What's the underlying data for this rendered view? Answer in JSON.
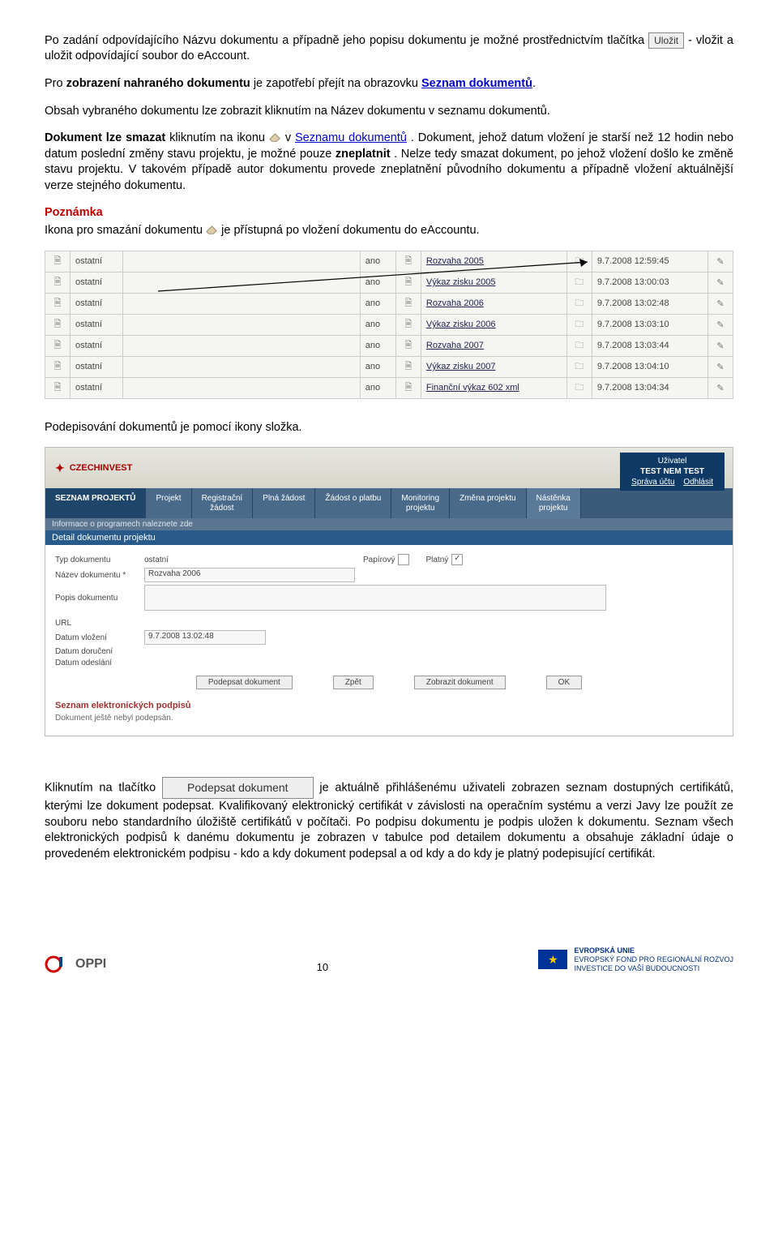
{
  "para1_a": "Po zadání odpovídajícího Názvu dokumentu a případně jeho popisu dokumentu je možné prostřednictvím tlačítka ",
  "btn_ulozit": "Uložit",
  "para1_b": " - vložit a uložit odpovídající soubor do eAccount.",
  "para2_a": "Pro ",
  "para2_b": "zobrazení nahraného dokumentu",
  "para2_c": " je zapotřebí přejít na obrazovku ",
  "para2_link": "Seznam dokumentů",
  "para2_d": ".",
  "para3": "Obsah vybraného dokumentu lze zobrazit kliknutím na Název dokumentu v seznamu dokumentů.",
  "para4_a": "Dokument lze smazat",
  "para4_b": " kliknutím na ikonu ",
  "para4_c": " v ",
  "para4_link": "Seznamu dokumentů",
  "para4_d": ". Dokument, jehož datum vložení je starší než 12 hodin nebo datum poslední změny stavu projektu, je možné pouze ",
  "para4_e": "zneplatnit",
  "para4_f": ". Nelze tedy smazat dokument, po jehož vložení došlo ke změně stavu projektu. V takovém případě autor dokumentu provede zneplatnění původního dokumentu a případně vložení aktuálnější verze stejného dokumentu.",
  "poznamka_label": "Poznámka",
  "poznamka_text_a": "Ikona pro smazání dokumentu ",
  "poznamka_text_b": " je přístupná po vložení dokumentu do eAccountu.",
  "table_rows": [
    {
      "type": "ostatní",
      "ano": "ano",
      "name": "Rozvaha 2005",
      "date": "9.7.2008 12:59:45"
    },
    {
      "type": "ostatní",
      "ano": "ano",
      "name": "Výkaz zisku 2005",
      "date": "9.7.2008 13:00:03"
    },
    {
      "type": "ostatní",
      "ano": "ano",
      "name": "Rozvaha 2006",
      "date": "9.7.2008 13:02:48"
    },
    {
      "type": "ostatní",
      "ano": "ano",
      "name": "Výkaz zisku 2006",
      "date": "9.7.2008 13:03:10"
    },
    {
      "type": "ostatní",
      "ano": "ano",
      "name": "Rozvaha 2007",
      "date": "9.7.2008 13:03:44"
    },
    {
      "type": "ostatní",
      "ano": "ano",
      "name": "Výkaz zisku 2007",
      "date": "9.7.2008 13:04:10"
    },
    {
      "type": "ostatní",
      "ano": "ano",
      "name": "Finanční výkaz 602 xml",
      "date": "9.7.2008 13:04:34"
    }
  ],
  "para_sign": "Podepisování dokumentů je pomocí ikony složka.",
  "app": {
    "brand": "CZECHINVEST",
    "user_label": "Uživatel",
    "user_name": "TEST NEM TEST",
    "link_sprava": "Správa účtu",
    "link_odhlasit": "Odhlásit",
    "tabs": [
      "SEZNAM PROJEKTŮ",
      "Projekt",
      "Registrační\nžádost",
      "Plná žádost",
      "Žádost o platbu",
      "Monitoring\nprojektu",
      "Změna projektu",
      "Nástěnka\nprojektu"
    ],
    "info_bar": "Informace o programech naleznete zde",
    "panel_title": "Detail dokumentu projektu",
    "fields": {
      "typ_label": "Typ dokumentu",
      "typ_value": "ostatní",
      "papirovy": "Papírový",
      "platny": "Platný",
      "nazev_label": "Název dokumentu *",
      "nazev_value": "Rozvaha 2006",
      "popis_label": "Popis dokumentu",
      "url_label": "URL",
      "dat_vlozeni_label": "Datum vložení",
      "dat_vlozeni_value": "9.7.2008 13:02:48",
      "dat_doruc_label": "Datum doručení",
      "dat_odes_label": "Datum odeslání"
    },
    "buttons": {
      "podepsat": "Podepsat dokument",
      "zpet": "Zpět",
      "zobrazit": "Zobrazit dokument",
      "ok": "OK"
    },
    "sig_title": "Seznam elektronických podpisů",
    "sig_note": "Dokument ještě nebyl podepsán."
  },
  "para_last_a": "Kliknutím na tlačítko ",
  "btn_podepsat_large": "Podepsat dokument",
  "para_last_b": " je aktuálně přihlášenému uživateli zobrazen seznam dostupných certifikátů, kterými lze dokument podepsat. Kvalifikovaný elektronický certifikát v závislosti na operačním systému a verzi Javy lze použít ze souboru nebo standardního úložiště certifikátů v počítači. Po podpisu dokumentu je podpis uložen k dokumentu. Seznam všech elektronických podpisů k danému dokumentu je zobrazen v tabulce pod detailem dokumentu a obsahuje základní údaje o provedeném elektronickém podpisu - kdo a kdy dokument podepsal a od kdy a do kdy je platný podepisující certifikát.",
  "footer": {
    "oppi": "OPPI",
    "page": "10",
    "eu1": "EVROPSKÁ UNIE",
    "eu2": "EVROPSKÝ FOND PRO REGIONÁLNÍ ROZVOJ",
    "eu3": "INVESTICE DO VAŠÍ BUDOUCNOSTI"
  }
}
